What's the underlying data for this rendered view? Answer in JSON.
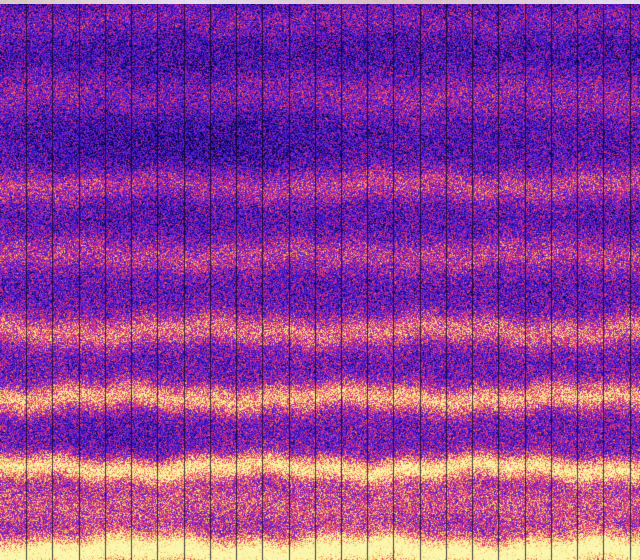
{
  "image": {
    "kind": "false-color spectrogram, no printed text",
    "colormap": [
      "#0b0330",
      "#1f10a8",
      "#3a1ad6",
      "#7a1fc8",
      "#c0279a",
      "#ea3f6e",
      "#f59a5a",
      "#f6ea86",
      "#fbf7b0"
    ],
    "background_color": "#1d0a6e",
    "divider_color": "#0a0418",
    "divider_count": 24,
    "top_strip_color": "#f3e6c8",
    "bright_band_color": "#f6ea86",
    "base_color": "#3a1ad6"
  }
}
